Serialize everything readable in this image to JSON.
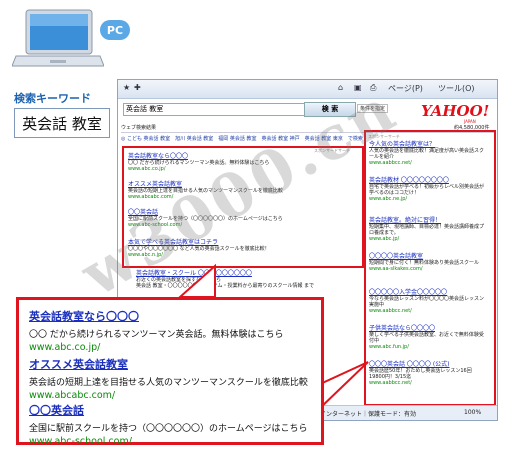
{
  "pc_badge": "PC",
  "keyword_label": "検索キーワード",
  "keyword": "英会話 教室",
  "browser": {
    "toolbar": {
      "page_label": "ページ(P)",
      "tools_label": "ツール(O)"
    },
    "search": {
      "query": "英会話 教室",
      "button": "検 索",
      "options": "条件を指定"
    },
    "logo": "YAHOO!",
    "logo_sub": "JAPAN",
    "results_label": "ウェブ検索結果",
    "results_count": "約4,580,000件",
    "categories": "◎ こども 英会話 教室　旭川 英会話 教室　福岡 英会話 教室　英会話 教室 神戸　英会話 教室 東京　で検索",
    "sponsor_label": "スポンサードサーチ",
    "top_ads": [
      {
        "title": "英会話教室なら〇〇〇",
        "desc": "〇〇 だから続けられるマンツーマン英会話。無料体験はこちら",
        "url": "www.abc.co.jp/"
      },
      {
        "title": "オススメ英会話教室",
        "desc": "英会話の短期上達を目指せる人気のマンツーマンスクールを徹底比較",
        "url": "www.abcabc.com/"
      },
      {
        "title": "〇〇英会話",
        "desc": "全国に駅前スクールを持つ（〇〇〇〇〇〇）のホームページはこちら",
        "url": "www.abc-school.com/"
      },
      {
        "title": "本気で学べる英会話教室はコチラ",
        "desc": "〇〇〇や〇〇〇〇〇〇 など人気の英会話スクールを徹底比較！",
        "url": "www.abc.n.jp/"
      }
    ],
    "organic": {
      "title": "英会話教室・スクール 〇〇〇〇〇〇〇〇〇",
      "desc": "お近くの英会話教室を探すならこちら",
      "desc2": "英会話 教室・〇〇〇〇〇〇、システム・授業料から最寄りのスクール情報 まで"
    },
    "right_sponsor_label": "スポンサーサーチ",
    "right_ads": [
      {
        "title": "今人気の英会話教室は？",
        "desc": "人気の英会話を徹底比較！満足度が高い英会話スクールを紹介",
        "url": "www.aabbcc.net/"
      },
      {
        "title": "英会話教材 〇〇〇〇〇〇〇〇",
        "desc": "自宅で英会話が学べる！初級からレベル別英会話が学べるのはココだけ！",
        "url": "www.abc.ne.jp/"
      },
      {
        "title": "英会話教室。絶対に習得！",
        "desc": "短期集中、現地講師、目標必達！英会話講師養成プロ養成まで。",
        "url": "www.abc.jp/"
      },
      {
        "title": "〇〇〇〇英会話教室",
        "desc": "短期間で身に付く！無料体験あり英会話スクール",
        "url": "www.aa-slkakes.com/"
      },
      {
        "title": "〇〇〇〇〇入学金〇〇〇〇〇",
        "desc": "今なら英会話レッスン料が〇〇〇〇英会話レッスン実施中",
        "url": "www.aabbcc.net/"
      },
      {
        "title": "子供英会話なら〇〇〇〇",
        "desc": "楽しく学べる子供英会話教室、お近くで無料体験受付中",
        "url": "www.abc.fun.jp/"
      },
      {
        "title": "〇〇〇英会話 〇〇〇〇 (公式)",
        "desc": "英会話歴50年！おためし英会話レッスン16回 19800円！3/15迄",
        "url": "www.aabbcc.net/"
      }
    ],
    "status": {
      "zone": "インターネット｜保護モード：有効",
      "zoom": "100%"
    }
  },
  "callout_ads": [
    {
      "title": "英会話教室なら〇〇〇",
      "desc": "〇〇 だから続けられるマンツーマン英会話。無料体験はこちら",
      "url": "www.abc.co.jp/"
    },
    {
      "title": "オススメ英会話教室",
      "desc": "英会話の短期上達を目指せる人気のマンツーマンスクールを徹底比較",
      "url": "www.abcabc.com/"
    },
    {
      "title": "〇〇英会話",
      "desc": "全国に駅前スクールを持つ（〇〇〇〇〇〇）のホームページはこちら",
      "url": "www.abc-school.com/"
    }
  ],
  "watermark": "w3000.cn",
  "colors": {
    "ad_box": "#e0141e",
    "link": "#1a2fbf",
    "url": "#0a8a0a",
    "badge": "#5aa9e6"
  }
}
